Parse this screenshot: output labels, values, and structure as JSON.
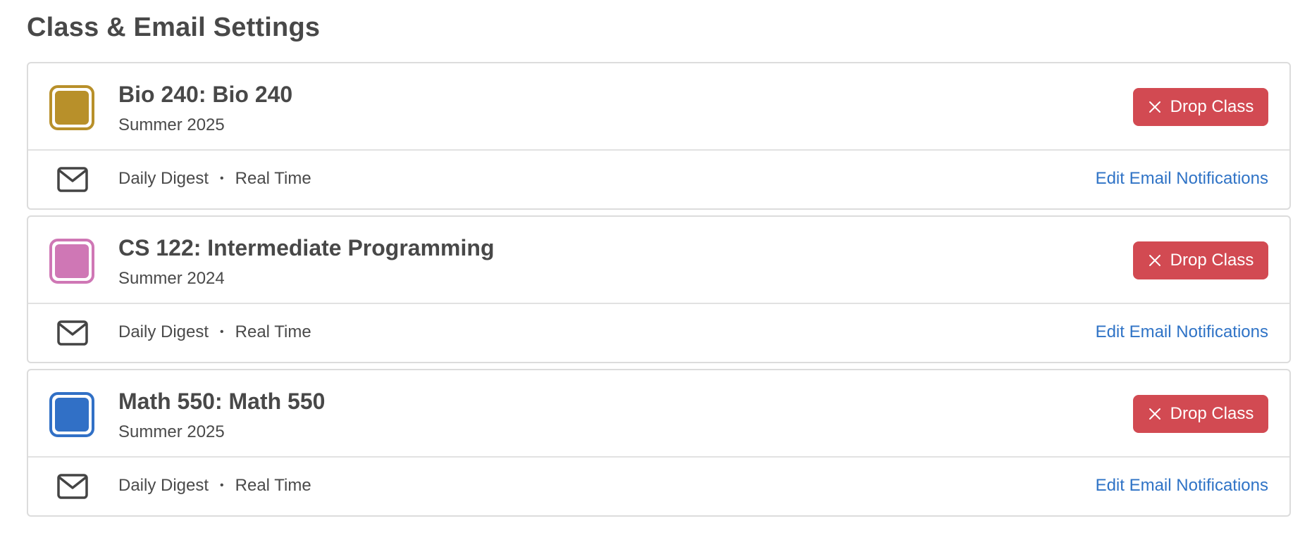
{
  "page": {
    "title": "Class & Email Settings"
  },
  "classes": [
    {
      "name": "Bio 240: Bio 240",
      "term": "Summer 2025",
      "color": "#b8902a",
      "drop_label": "Drop Class",
      "frequency_1": "Daily Digest",
      "separator": "•",
      "frequency_2": "Real Time",
      "edit_label": "Edit Email Notifications"
    },
    {
      "name": "CS 122: Intermediate Programming",
      "term": "Summer 2024",
      "color": "#cf77b5",
      "drop_label": "Drop Class",
      "frequency_1": "Daily Digest",
      "separator": "•",
      "frequency_2": "Real Time",
      "edit_label": "Edit Email Notifications"
    },
    {
      "name": "Math 550: Math 550",
      "term": "Summer 2025",
      "color": "#3170c6",
      "drop_label": "Drop Class",
      "frequency_1": "Daily Digest",
      "separator": "•",
      "frequency_2": "Real Time",
      "edit_label": "Edit Email Notifications"
    }
  ],
  "icons": {
    "drop": "close-icon",
    "email": "envelope-icon"
  }
}
